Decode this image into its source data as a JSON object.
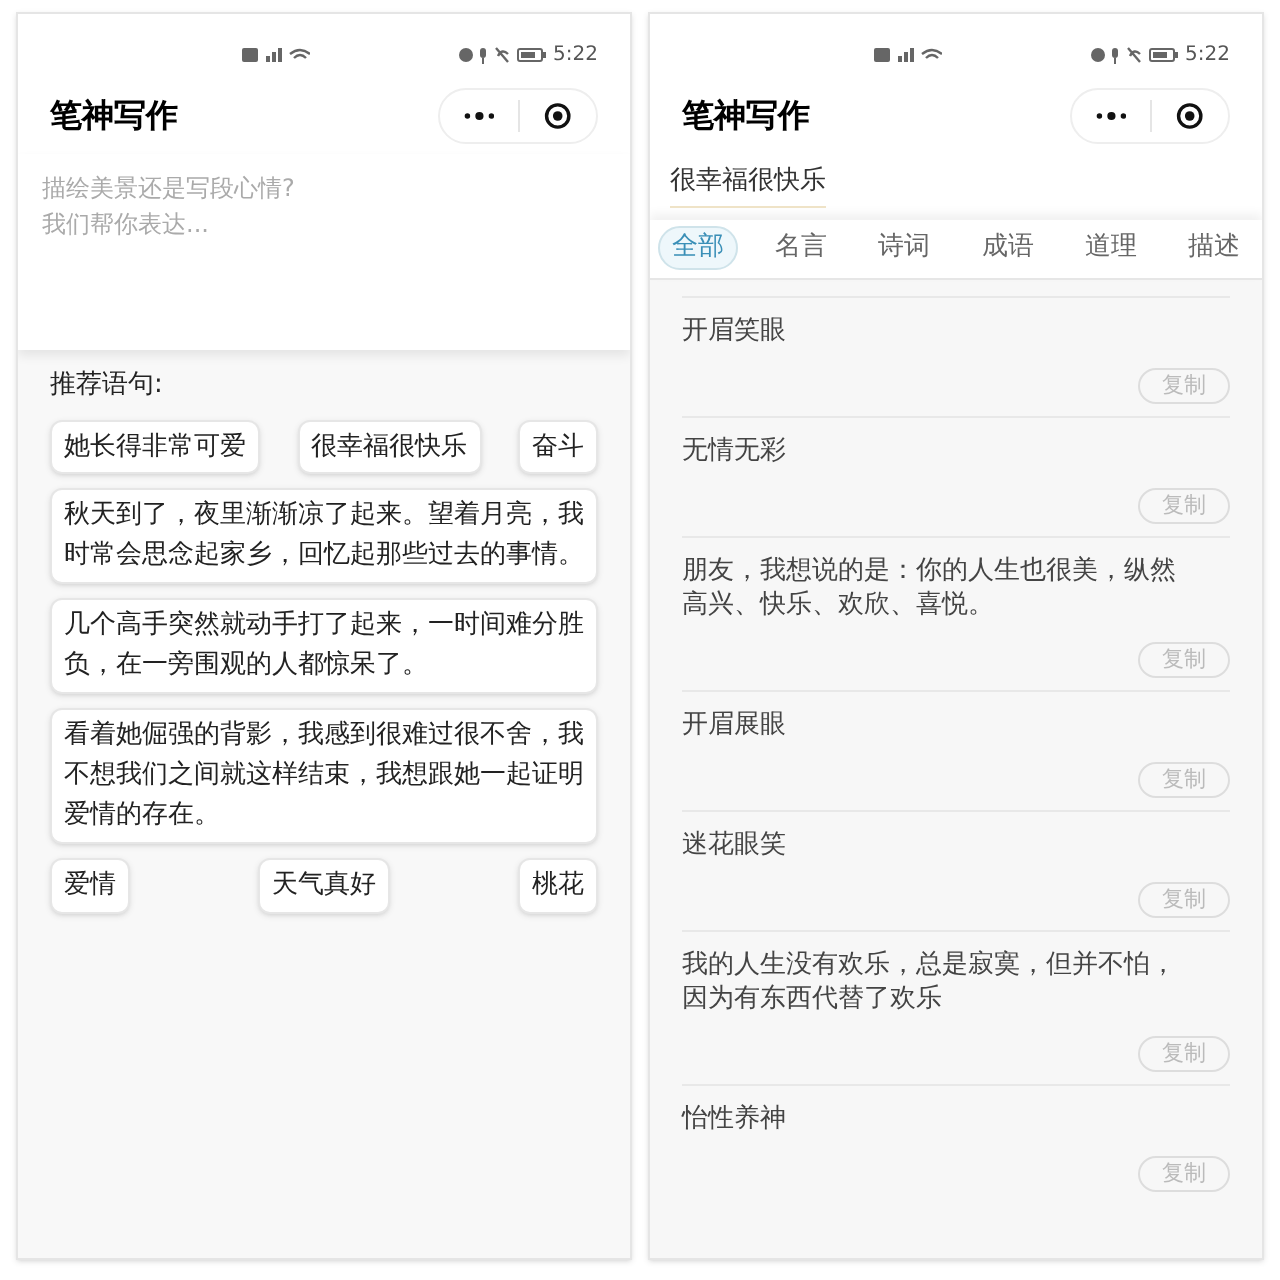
{
  "compose_screen": {
    "status_bar": {
      "time": "5:22"
    },
    "title": "笔神写作",
    "input": {
      "placeholder": "描绘美景还是写段心情?\n我们帮你表达..."
    },
    "section_label": "推荐语句:",
    "suggestions": [
      {
        "kind": "chip_row",
        "chips": [
          "她长得非常可爱",
          "很幸福很快乐",
          "奋斗"
        ]
      },
      {
        "kind": "sentence",
        "text": "秋天到了，夜里渐渐凉了起来。望着月亮，我时常会思念起家乡，回忆起那些过去的事情。"
      },
      {
        "kind": "sentence",
        "text": "几个高手突然就动手打了起来，一时间难分胜负，在一旁围观的人都惊呆了。"
      },
      {
        "kind": "sentence",
        "text": "看着她倔强的背影，我感到很难过很不舍，我不想我们之间就这样结束，我想跟她一起证明爱情的存在。"
      },
      {
        "kind": "chip_row",
        "chips": [
          "爱情",
          "天气真好",
          "桃花"
        ]
      }
    ]
  },
  "results_screen": {
    "status_bar": {
      "time": "5:22"
    },
    "title": "笔神写作",
    "query": "很幸福很快乐",
    "tabs": [
      {
        "label": "全部",
        "selected": true
      },
      {
        "label": "名言",
        "selected": false
      },
      {
        "label": "诗词",
        "selected": false
      },
      {
        "label": "成语",
        "selected": false
      },
      {
        "label": "道理",
        "selected": false
      },
      {
        "label": "描述",
        "selected": false
      }
    ],
    "results": [
      {
        "text": "开眉笑眼",
        "copy_label": "复制"
      },
      {
        "text": "无情无彩",
        "copy_label": "复制"
      },
      {
        "text": "朋友，我想说的是：你的人生也很美，纵然高兴、快乐、欢欣、喜悦。",
        "copy_label": "复制"
      },
      {
        "text": "开眉展眼",
        "copy_label": "复制"
      },
      {
        "text": "迷花眼笑",
        "copy_label": "复制"
      },
      {
        "text": "我的人生没有欢乐，总是寂寞，但并不怕，因为有东西代替了欢乐",
        "copy_label": "复制"
      },
      {
        "text": "怡性养神",
        "copy_label": "复制"
      }
    ]
  }
}
